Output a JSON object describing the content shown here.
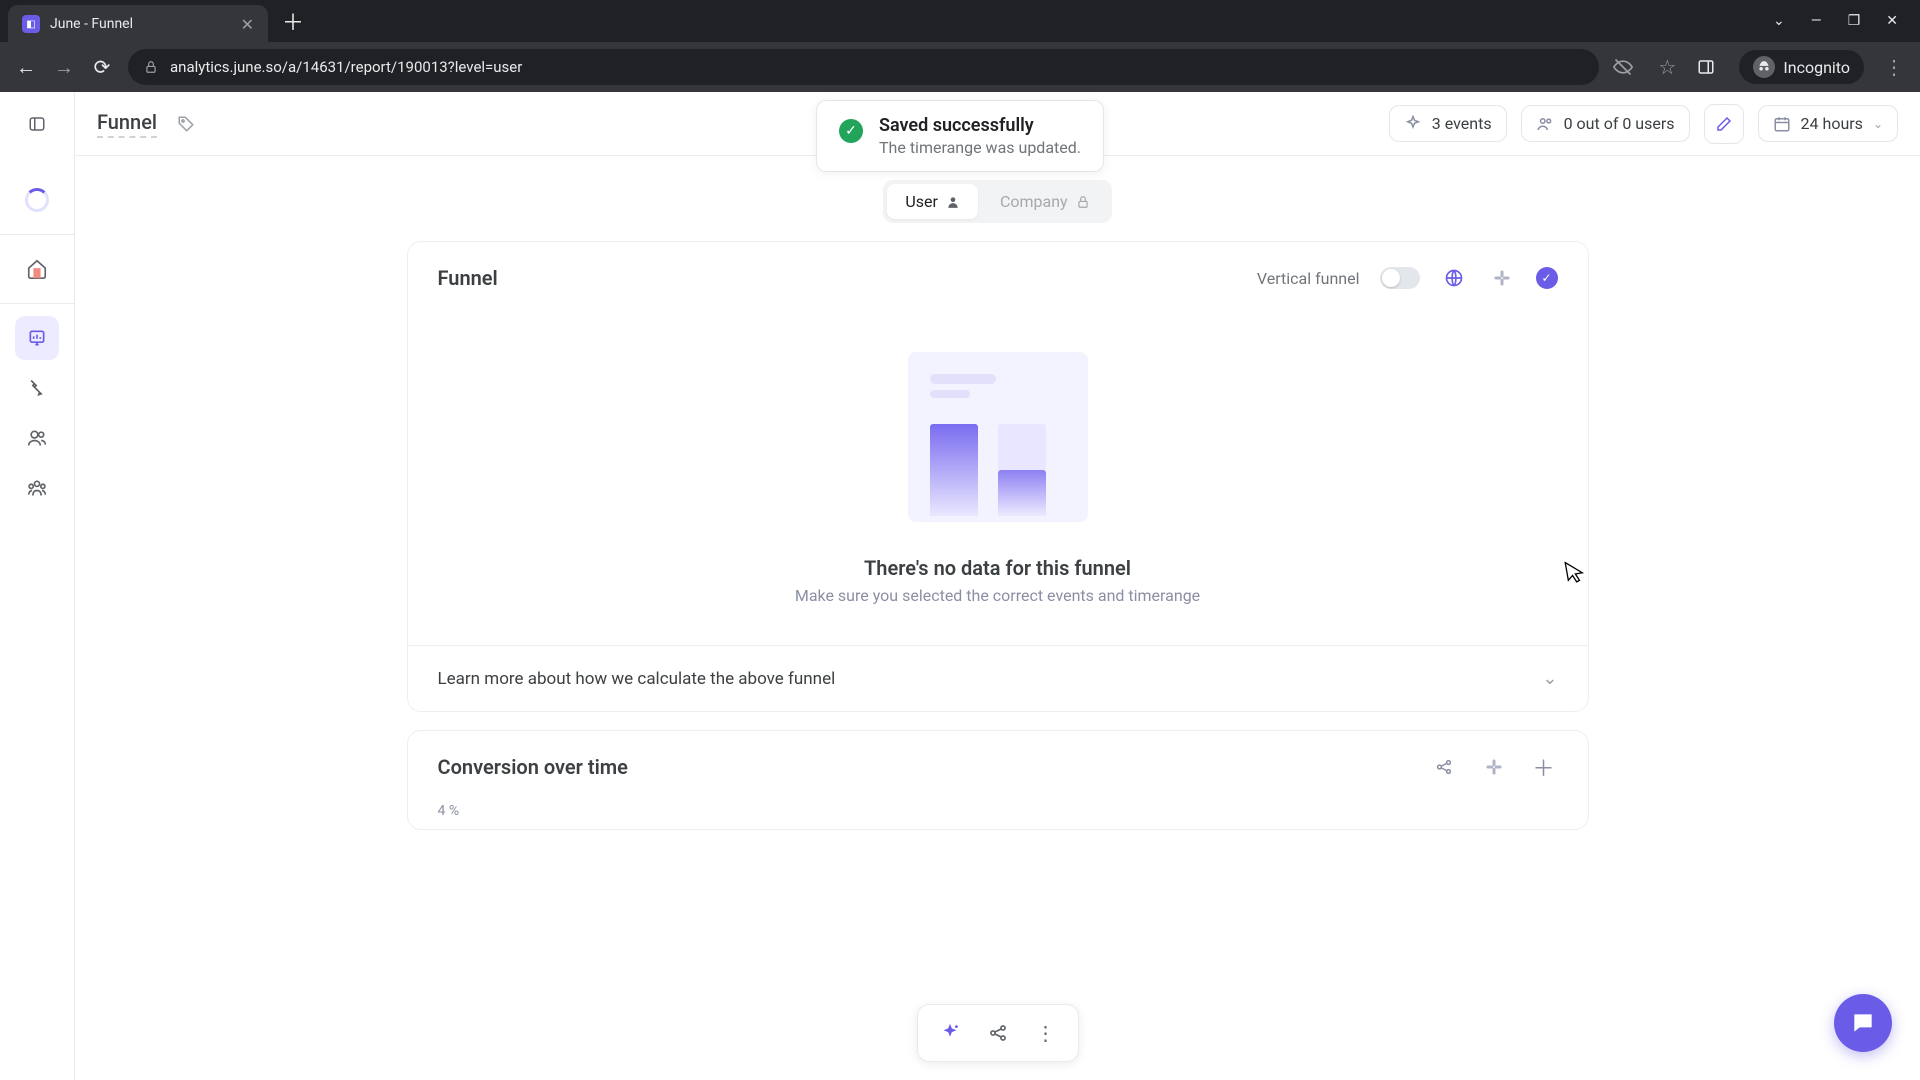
{
  "browser": {
    "tab_title": "June - Funnel",
    "url": "analytics.june.so/a/14631/report/190013?level=user",
    "incognito_label": "Incognito"
  },
  "header": {
    "page_title": "Funnel",
    "events_label": "3 events",
    "users_label": "0 out of 0 users",
    "timerange_label": "24 hours"
  },
  "toast": {
    "title": "Saved successfully",
    "subtitle": "The timerange was updated."
  },
  "segmented": {
    "user": "User",
    "company": "Company"
  },
  "funnel_card": {
    "title": "Funnel",
    "vertical_label": "Vertical funnel",
    "empty_title": "There's no data for this funnel",
    "empty_subtitle": "Make sure you selected the correct events and timerange",
    "learn_more": "Learn more about how we calculate the above funnel"
  },
  "conversion_card": {
    "title": "Conversion over time",
    "y_tick": "4 %"
  },
  "chart_data": {
    "type": "bar",
    "title": "Funnel",
    "categories": [],
    "values": [],
    "note": "empty state — no data rendered"
  },
  "colors": {
    "accent": "#6b5ce7",
    "success": "#22a55a"
  }
}
